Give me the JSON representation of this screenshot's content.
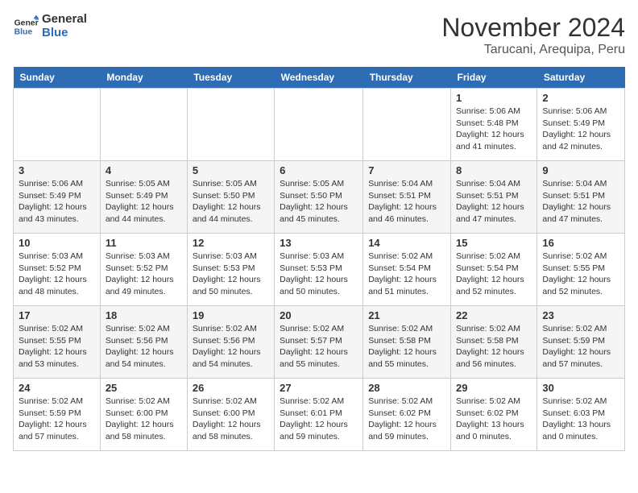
{
  "header": {
    "logo_line1": "General",
    "logo_line2": "Blue",
    "title": "November 2024",
    "subtitle": "Tarucani, Arequipa, Peru"
  },
  "weekdays": [
    "Sunday",
    "Monday",
    "Tuesday",
    "Wednesday",
    "Thursday",
    "Friday",
    "Saturday"
  ],
  "weeks": [
    [
      {
        "day": "",
        "info": ""
      },
      {
        "day": "",
        "info": ""
      },
      {
        "day": "",
        "info": ""
      },
      {
        "day": "",
        "info": ""
      },
      {
        "day": "",
        "info": ""
      },
      {
        "day": "1",
        "info": "Sunrise: 5:06 AM\nSunset: 5:48 PM\nDaylight: 12 hours and 41 minutes."
      },
      {
        "day": "2",
        "info": "Sunrise: 5:06 AM\nSunset: 5:49 PM\nDaylight: 12 hours and 42 minutes."
      }
    ],
    [
      {
        "day": "3",
        "info": "Sunrise: 5:06 AM\nSunset: 5:49 PM\nDaylight: 12 hours and 43 minutes."
      },
      {
        "day": "4",
        "info": "Sunrise: 5:05 AM\nSunset: 5:49 PM\nDaylight: 12 hours and 44 minutes."
      },
      {
        "day": "5",
        "info": "Sunrise: 5:05 AM\nSunset: 5:50 PM\nDaylight: 12 hours and 44 minutes."
      },
      {
        "day": "6",
        "info": "Sunrise: 5:05 AM\nSunset: 5:50 PM\nDaylight: 12 hours and 45 minutes."
      },
      {
        "day": "7",
        "info": "Sunrise: 5:04 AM\nSunset: 5:51 PM\nDaylight: 12 hours and 46 minutes."
      },
      {
        "day": "8",
        "info": "Sunrise: 5:04 AM\nSunset: 5:51 PM\nDaylight: 12 hours and 47 minutes."
      },
      {
        "day": "9",
        "info": "Sunrise: 5:04 AM\nSunset: 5:51 PM\nDaylight: 12 hours and 47 minutes."
      }
    ],
    [
      {
        "day": "10",
        "info": "Sunrise: 5:03 AM\nSunset: 5:52 PM\nDaylight: 12 hours and 48 minutes."
      },
      {
        "day": "11",
        "info": "Sunrise: 5:03 AM\nSunset: 5:52 PM\nDaylight: 12 hours and 49 minutes."
      },
      {
        "day": "12",
        "info": "Sunrise: 5:03 AM\nSunset: 5:53 PM\nDaylight: 12 hours and 50 minutes."
      },
      {
        "day": "13",
        "info": "Sunrise: 5:03 AM\nSunset: 5:53 PM\nDaylight: 12 hours and 50 minutes."
      },
      {
        "day": "14",
        "info": "Sunrise: 5:02 AM\nSunset: 5:54 PM\nDaylight: 12 hours and 51 minutes."
      },
      {
        "day": "15",
        "info": "Sunrise: 5:02 AM\nSunset: 5:54 PM\nDaylight: 12 hours and 52 minutes."
      },
      {
        "day": "16",
        "info": "Sunrise: 5:02 AM\nSunset: 5:55 PM\nDaylight: 12 hours and 52 minutes."
      }
    ],
    [
      {
        "day": "17",
        "info": "Sunrise: 5:02 AM\nSunset: 5:55 PM\nDaylight: 12 hours and 53 minutes."
      },
      {
        "day": "18",
        "info": "Sunrise: 5:02 AM\nSunset: 5:56 PM\nDaylight: 12 hours and 54 minutes."
      },
      {
        "day": "19",
        "info": "Sunrise: 5:02 AM\nSunset: 5:56 PM\nDaylight: 12 hours and 54 minutes."
      },
      {
        "day": "20",
        "info": "Sunrise: 5:02 AM\nSunset: 5:57 PM\nDaylight: 12 hours and 55 minutes."
      },
      {
        "day": "21",
        "info": "Sunrise: 5:02 AM\nSunset: 5:58 PM\nDaylight: 12 hours and 55 minutes."
      },
      {
        "day": "22",
        "info": "Sunrise: 5:02 AM\nSunset: 5:58 PM\nDaylight: 12 hours and 56 minutes."
      },
      {
        "day": "23",
        "info": "Sunrise: 5:02 AM\nSunset: 5:59 PM\nDaylight: 12 hours and 57 minutes."
      }
    ],
    [
      {
        "day": "24",
        "info": "Sunrise: 5:02 AM\nSunset: 5:59 PM\nDaylight: 12 hours and 57 minutes."
      },
      {
        "day": "25",
        "info": "Sunrise: 5:02 AM\nSunset: 6:00 PM\nDaylight: 12 hours and 58 minutes."
      },
      {
        "day": "26",
        "info": "Sunrise: 5:02 AM\nSunset: 6:00 PM\nDaylight: 12 hours and 58 minutes."
      },
      {
        "day": "27",
        "info": "Sunrise: 5:02 AM\nSunset: 6:01 PM\nDaylight: 12 hours and 59 minutes."
      },
      {
        "day": "28",
        "info": "Sunrise: 5:02 AM\nSunset: 6:02 PM\nDaylight: 12 hours and 59 minutes."
      },
      {
        "day": "29",
        "info": "Sunrise: 5:02 AM\nSunset: 6:02 PM\nDaylight: 13 hours and 0 minutes."
      },
      {
        "day": "30",
        "info": "Sunrise: 5:02 AM\nSunset: 6:03 PM\nDaylight: 13 hours and 0 minutes."
      }
    ]
  ],
  "colors": {
    "header_bg": "#2e6db4",
    "header_text": "#ffffff",
    "logo_blue": "#2e6db4"
  }
}
